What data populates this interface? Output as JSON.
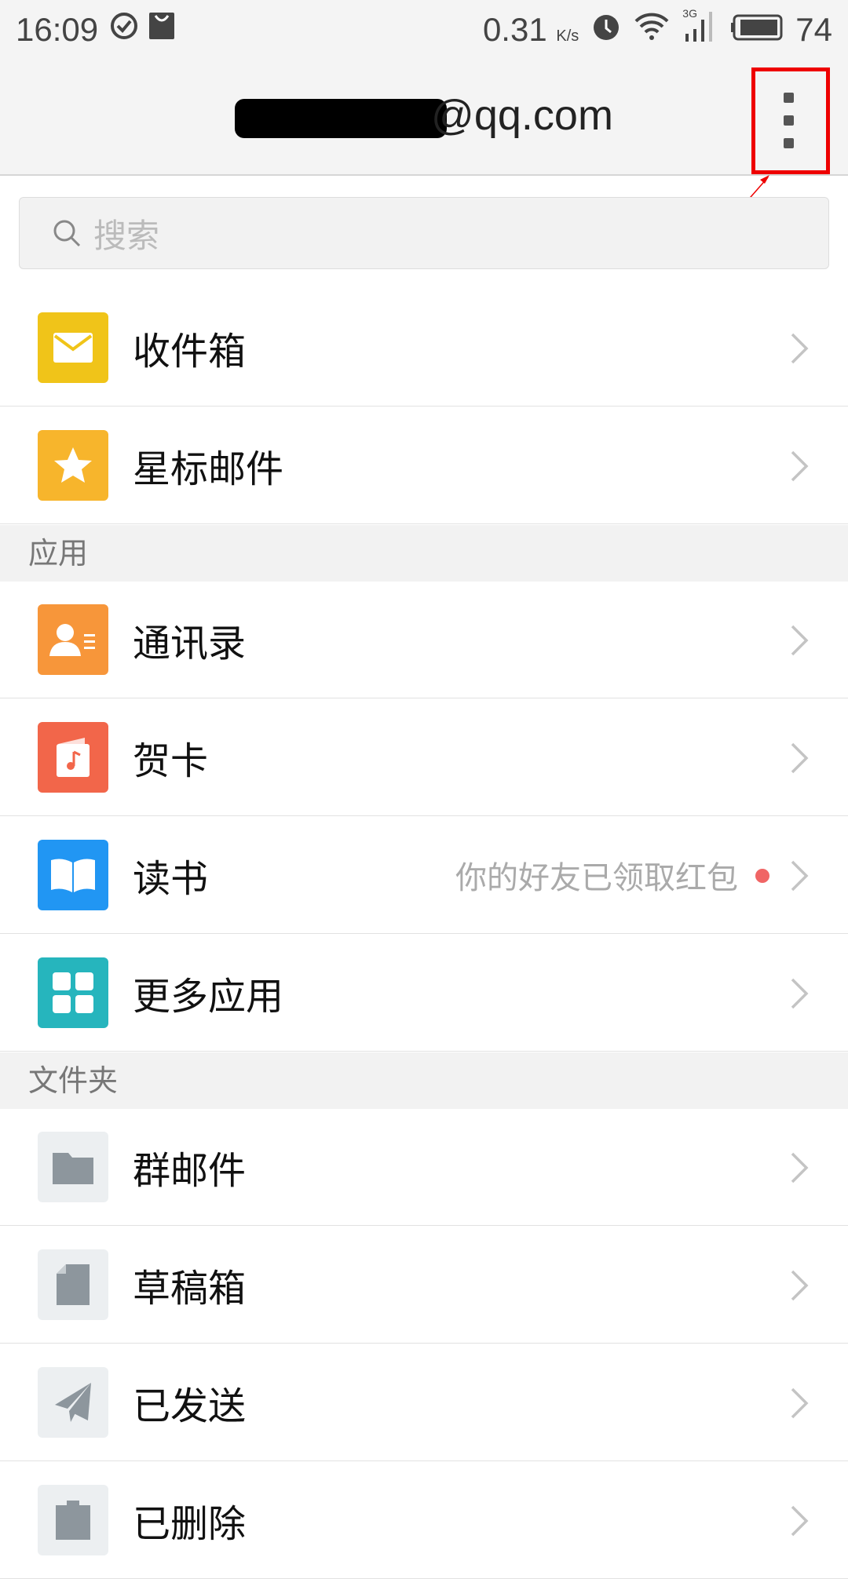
{
  "status_bar": {
    "time": "16:09",
    "speed": "0.31",
    "speed_unit": "K/s",
    "battery": "74",
    "network": "3G"
  },
  "header": {
    "email_suffix": "@qq.com",
    "more_icon": "more-vertical-icon"
  },
  "search": {
    "placeholder": "搜索"
  },
  "top_items": [
    {
      "label": "收件箱",
      "icon": "mail-icon",
      "color": "#f0c419"
    },
    {
      "label": "星标邮件",
      "icon": "star-icon",
      "color": "#f7b52c"
    }
  ],
  "sections": [
    {
      "title": "应用",
      "items": [
        {
          "label": "通讯录",
          "icon": "contacts-icon",
          "color": "#f7963a"
        },
        {
          "label": "贺卡",
          "icon": "card-icon",
          "color": "#f2664a"
        },
        {
          "label": "读书",
          "icon": "book-icon",
          "color": "#2196f3",
          "hint": "你的好友已领取红包",
          "badge": true
        },
        {
          "label": "更多应用",
          "icon": "apps-icon",
          "color": "#26b5bd"
        }
      ]
    },
    {
      "title": "文件夹",
      "items": [
        {
          "label": "群邮件",
          "icon": "folder-icon",
          "color": "#eceff1"
        },
        {
          "label": "草稿箱",
          "icon": "draft-icon",
          "color": "#eceff1"
        },
        {
          "label": "已发送",
          "icon": "send-icon",
          "color": "#eceff1"
        },
        {
          "label": "已删除",
          "icon": "trash-icon",
          "color": "#eceff1"
        }
      ]
    }
  ],
  "annotation_color": "#e00000"
}
